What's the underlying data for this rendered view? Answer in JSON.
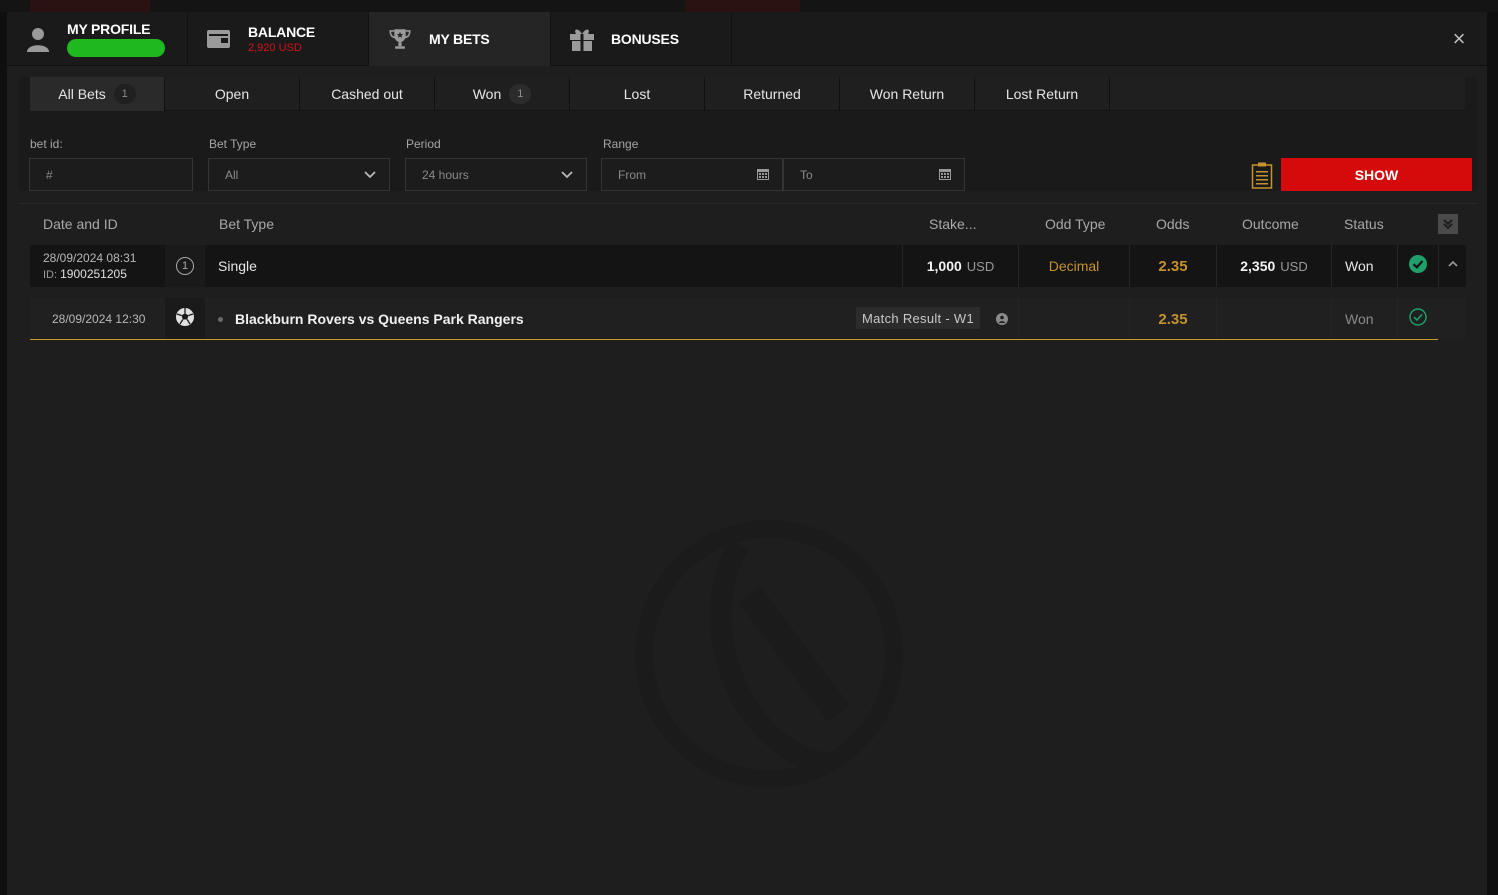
{
  "header": {
    "tabs": [
      {
        "id": "profile",
        "label": "MY PROFILE",
        "icon": "user-icon"
      },
      {
        "id": "balance",
        "label": "BALANCE",
        "sub": "2,920 USD",
        "icon": "wallet-icon"
      },
      {
        "id": "mybets",
        "label": "MY BETS",
        "icon": "trophy-icon",
        "active": true
      },
      {
        "id": "bonuses",
        "label": "BONUSES",
        "icon": "gift-icon"
      }
    ],
    "close_symbol": "×"
  },
  "subtabs": [
    {
      "label": "All Bets",
      "badge": "1",
      "active": true
    },
    {
      "label": "Open"
    },
    {
      "label": "Cashed out"
    },
    {
      "label": "Won",
      "badge": "1"
    },
    {
      "label": "Lost"
    },
    {
      "label": "Returned"
    },
    {
      "label": "Won Return"
    },
    {
      "label": "Lost Return"
    }
  ],
  "filters": {
    "bet_id_label": "bet id:",
    "bet_id_placeholder": "#",
    "bet_type_label": "Bet Type",
    "bet_type_value": "All",
    "period_label": "Period",
    "period_value": "24 hours",
    "range_label": "Range",
    "range_from": "From",
    "range_to": "To",
    "show_label": "SHOW"
  },
  "table": {
    "headers": {
      "date": "Date and ID",
      "bet_type": "Bet Type",
      "stake": "Stake...",
      "odd_type": "Odd Type",
      "odds": "Odds",
      "outcome": "Outcome",
      "status": "Status"
    },
    "bet": {
      "datetime": "28/09/2024 08:31",
      "id_label": "ID:",
      "id": "1900251205",
      "count": "1",
      "type": "Single",
      "stake": "1,000",
      "stake_currency": "USD",
      "odd_type": "Decimal",
      "odds": "2.35",
      "outcome": "2,350",
      "outcome_currency": "USD",
      "status": "Won"
    },
    "selection": {
      "datetime": "28/09/2024 12:30",
      "match": "Blackburn Rovers vs Queens Park Rangers",
      "market": "Match Result - W1",
      "odds": "2.35",
      "status": "Won"
    }
  },
  "colors": {
    "accent_red": "#d50b0b",
    "gold": "#c5922e",
    "success_green": "#1fa06a"
  }
}
